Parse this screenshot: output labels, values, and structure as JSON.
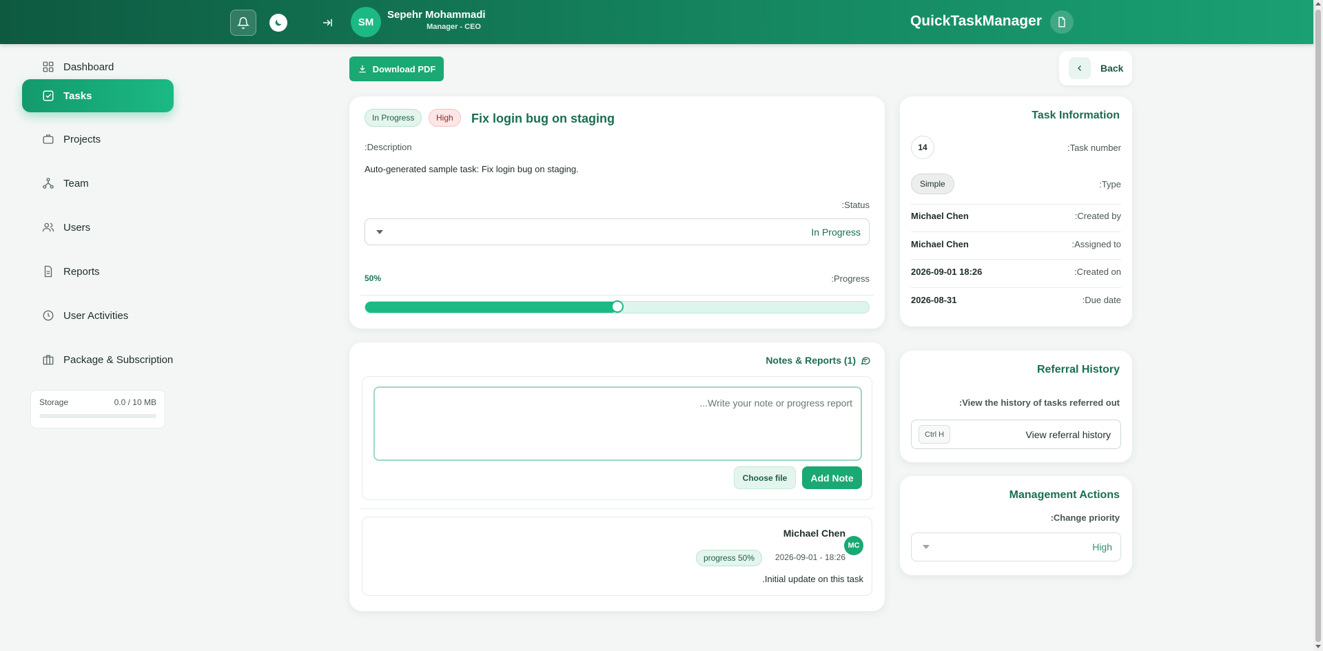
{
  "header": {
    "user_initials": "SM",
    "user_name": "Sepehr Mohammadi",
    "user_role": "Manager - CEO",
    "brand": "QuickTaskManager"
  },
  "sidebar": {
    "items": [
      {
        "label": "Dashboard",
        "icon": "grid-icon"
      },
      {
        "label": "Tasks",
        "icon": "checkbox-icon",
        "active": true
      },
      {
        "label": "Projects",
        "icon": "briefcase-icon"
      },
      {
        "label": "Team",
        "icon": "hierarchy-icon"
      },
      {
        "label": "Users",
        "icon": "users-icon"
      },
      {
        "label": "Reports",
        "icon": "document-icon"
      },
      {
        "label": "User Activities",
        "icon": "clock-icon"
      },
      {
        "label": "Package & Subscription",
        "icon": "package-icon"
      }
    ],
    "storage": {
      "label": "Storage",
      "value": "0.0 / 10 MB",
      "fraction": 0.0
    }
  },
  "toolbar": {
    "download_pdf": "Download PDF",
    "back": "Back"
  },
  "task": {
    "status_badge": "In Progress",
    "priority_badge": "High",
    "title": "Fix login bug on staging",
    "description_label": ":Description",
    "description": "Auto-generated sample task: Fix login bug on staging.",
    "status_label": ":Status",
    "status_value": "In Progress",
    "progress_label": ":Progress",
    "progress_text": "50%",
    "progress_fraction": 0.5
  },
  "notes": {
    "title": "Notes & Reports (1)",
    "placeholder": "...Write your note or progress report",
    "choose_file": "Choose file",
    "add_note": "Add Note",
    "items": [
      {
        "author": "Michael Chen",
        "initials": "MC",
        "badge": "progress 50%",
        "date": "2026-09-01 - 18:26",
        "text": ".Initial update on this task"
      }
    ]
  },
  "info": {
    "title": "Task Information",
    "rows": [
      {
        "key": ":Task number",
        "value": "14"
      },
      {
        "key": ":Type",
        "value": "Simple"
      },
      {
        "key": ":Created by",
        "value": "Michael Chen"
      },
      {
        "key": ":Assigned to",
        "value": "Michael Chen"
      },
      {
        "key": ":Created on",
        "value": "2026-09-01 18:26"
      },
      {
        "key": ":Due date",
        "value": "2026-08-31"
      }
    ]
  },
  "referral": {
    "title": "Referral History",
    "subtitle": ":View the history of tasks referred out",
    "shortcut": "Ctrl H",
    "button": "View referral history"
  },
  "management": {
    "title": "Management Actions",
    "subtitle": ":Change priority",
    "priority_value": "High"
  },
  "colors": {
    "accent": "#1cb985",
    "header_dark": "#0e5a41",
    "title_green": "#1a6e52"
  }
}
